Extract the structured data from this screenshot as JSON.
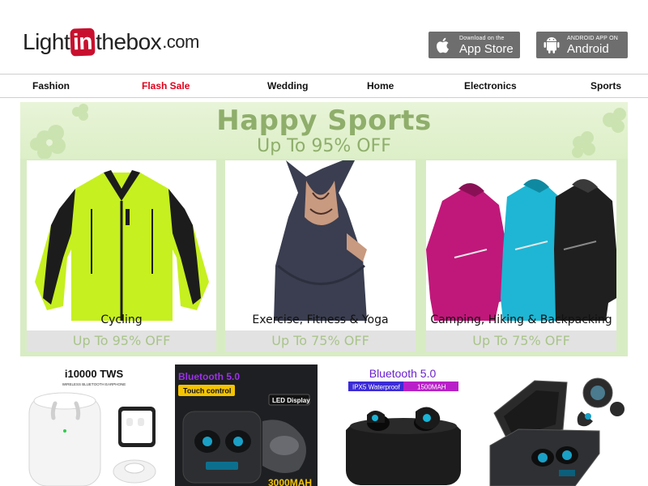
{
  "header": {
    "logo": {
      "part1": "Light",
      "in": "in",
      "part2": "thebox",
      "com": ".com"
    },
    "app_store": {
      "small": "Download on the",
      "big": "App Store",
      "icon": "apple-icon"
    },
    "android": {
      "small": "ANDROID APP ON",
      "big": "Android",
      "icon": "android-icon"
    }
  },
  "nav": {
    "items": [
      "Fashion",
      "Flash Sale",
      "Wedding",
      "Home",
      "Electronics",
      "Sports"
    ]
  },
  "banner": {
    "title": "Happy Sports",
    "subtitle": "Up To 95% OFF",
    "cards": [
      {
        "name": "Cycling",
        "offer": "Up To 95% OFF"
      },
      {
        "name": "Exercise, Fitness & Yoga",
        "offer": "Up To 75% OFF"
      },
      {
        "name": "Camping, Hiking & Backpacking",
        "offer": "Up To 75% OFF"
      }
    ]
  },
  "products": [
    {
      "heading": "i10000 TWS",
      "sub": "WIRELESS BLUETOOTH EARPHONE"
    },
    {
      "heading": "Bluetooth 5.0",
      "badge": "Touch control",
      "label": "LED Display",
      "bottom": "3000MAH"
    },
    {
      "heading": "Bluetooth 5.0",
      "badge1": "IPX5 Waterproof",
      "badge2": "1500MAH"
    },
    {
      "heading": ""
    }
  ],
  "colors": {
    "accent_red": "#e0001b",
    "banner_green": "#8fae6b",
    "store_btn": "#6e6e6e"
  }
}
